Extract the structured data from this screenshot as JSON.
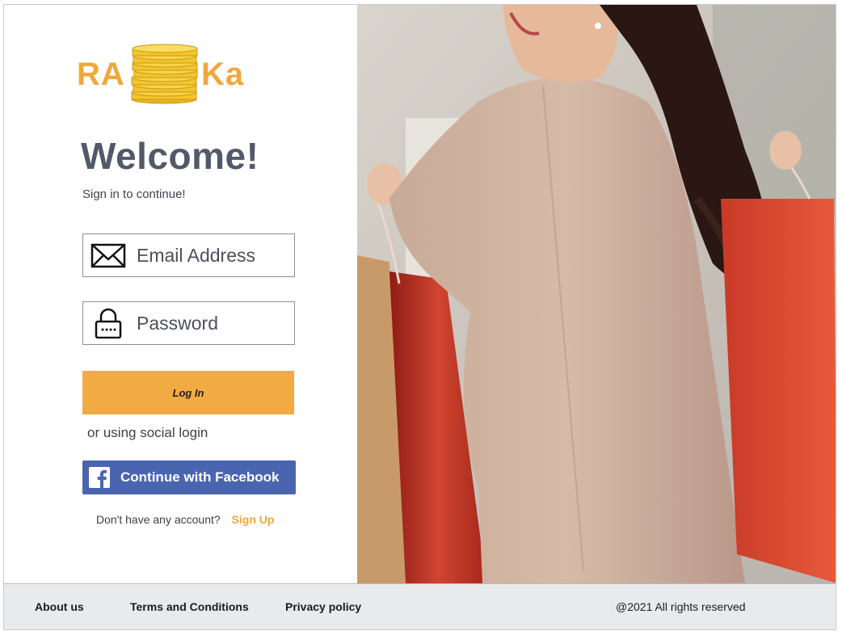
{
  "brand": {
    "left_text": "RA",
    "right_text": "Ka",
    "color": "#f0a83c"
  },
  "login": {
    "title": "Welcome!",
    "subtitle": "Sign in to continue!",
    "email_placeholder": "Email Address",
    "password_placeholder": "Password",
    "login_button": "Log In",
    "social_text": "or using social login",
    "facebook_button": "Continue with Facebook",
    "signup_prompt": "Don't have any account?",
    "signup_link": "Sign Up"
  },
  "colors": {
    "accent": "#f2aa44",
    "facebook": "#4a65b0",
    "footer_bg": "#e9eaec"
  },
  "icons": [
    "coins-stack-icon",
    "envelope-icon",
    "lock-icon",
    "facebook-icon"
  ],
  "footer": {
    "about": "About us",
    "terms": "Terms and Conditions",
    "privacy": "Privacy policy",
    "copyright": "@2021 All rights reserved"
  }
}
